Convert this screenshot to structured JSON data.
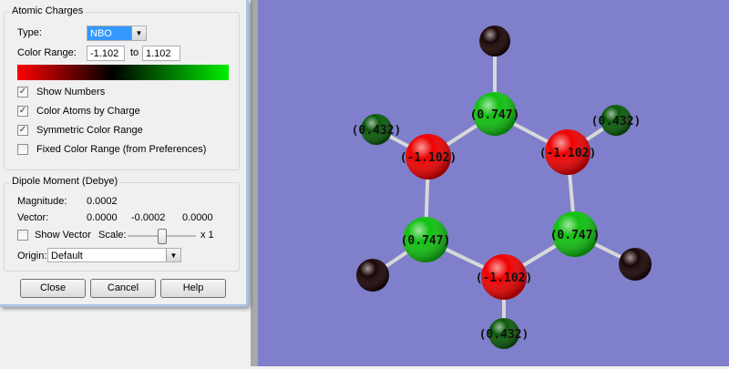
{
  "atomic_charges": {
    "title": "Atomic Charges",
    "type_label": "Type:",
    "type_value": "NBO",
    "color_range_label": "Color Range:",
    "range_min": "-1.102",
    "range_to": "to",
    "range_max": "1.102",
    "checkboxes": [
      {
        "label": "Show Numbers",
        "checked": true
      },
      {
        "label": "Color Atoms by Charge",
        "checked": true
      },
      {
        "label": "Symmetric Color Range",
        "checked": true
      },
      {
        "label": "Fixed Color Range (from Preferences)",
        "checked": false
      }
    ]
  },
  "dipole": {
    "title": "Dipole Moment (Debye)",
    "magnitude_label": "Magnitude:",
    "magnitude": "0.0002",
    "vector_label": "Vector:",
    "vector": [
      "0.0000",
      "-0.0002",
      "0.0000"
    ],
    "show_vector_label": "Show Vector",
    "show_vector_checked": false,
    "scale_label": "Scale:",
    "scale_value": "x 1",
    "scale_fraction": 0.5,
    "origin_label": "Origin:",
    "origin_value": "Default"
  },
  "buttons": {
    "close": "Close",
    "cancel": "Cancel",
    "help": "Help"
  },
  "molecule": {
    "atoms": [
      {
        "el": "H",
        "label": "(      )",
        "color": "#1a0505"
      },
      {
        "el": "C",
        "label": "(0.747)",
        "color": "#10c010"
      },
      {
        "el": "N",
        "label": "(-1.102)",
        "color": "#ee0000"
      },
      {
        "el": "N",
        "label": "(-1.102)",
        "color": "#ee0000"
      },
      {
        "el": "H",
        "label": "(0.432)",
        "color": "#0a5a0a"
      },
      {
        "el": "H",
        "label": "(0.432)",
        "color": "#0a5a0a"
      },
      {
        "el": "C",
        "label": "(0.747)",
        "color": "#10c010"
      },
      {
        "el": "C",
        "label": "(0.747)",
        "color": "#10c010"
      },
      {
        "el": "H",
        "label": "(      )",
        "color": "#1a0505"
      },
      {
        "el": "H",
        "label": "(      )",
        "color": "#1a0505"
      },
      {
        "el": "N",
        "label": "(-1.102)",
        "color": "#ee0000"
      },
      {
        "el": "H",
        "label": "(0.432)",
        "color": "#0a5a0a"
      }
    ],
    "bonds": [
      [
        0,
        1
      ],
      [
        1,
        2
      ],
      [
        1,
        3
      ],
      [
        2,
        4
      ],
      [
        3,
        5
      ],
      [
        2,
        6
      ],
      [
        3,
        7
      ],
      [
        6,
        10
      ],
      [
        7,
        10
      ],
      [
        6,
        8
      ],
      [
        7,
        9
      ],
      [
        10,
        11
      ]
    ]
  }
}
